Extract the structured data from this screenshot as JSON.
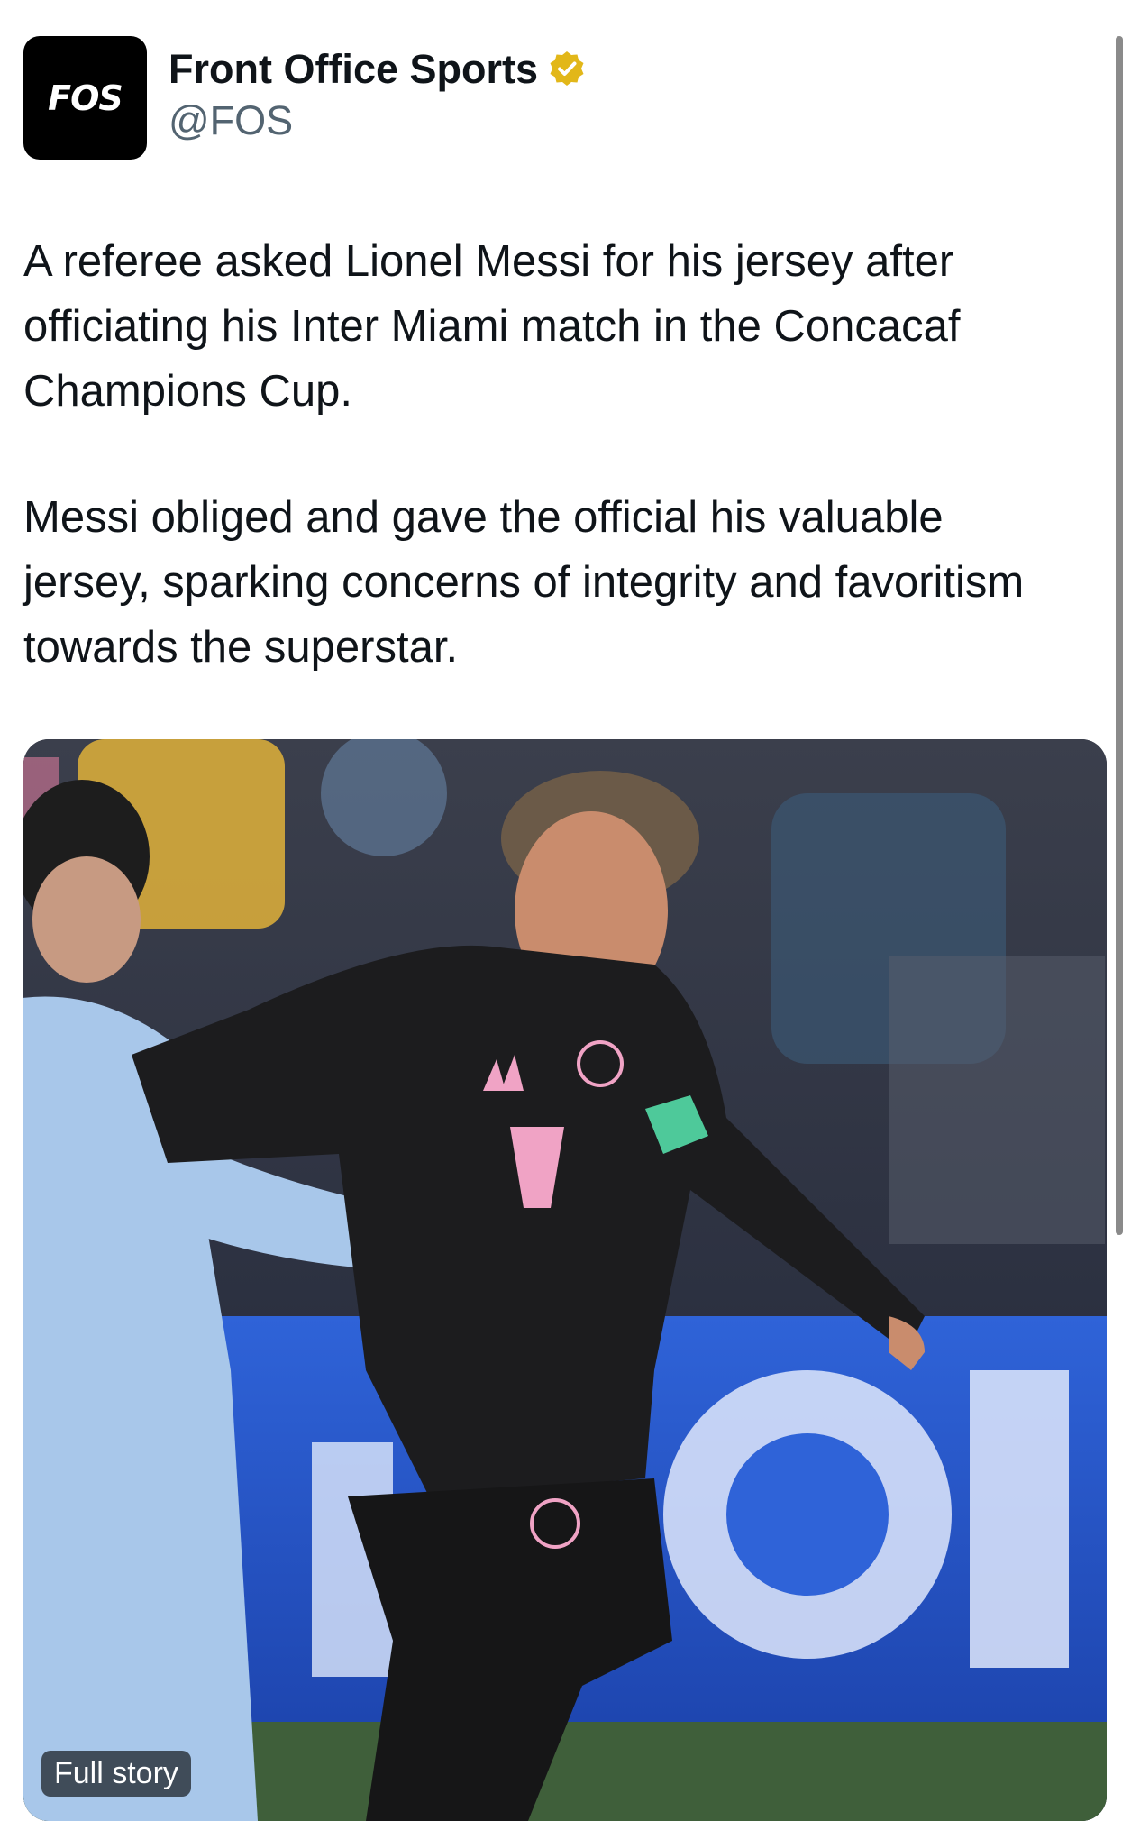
{
  "account": {
    "avatar_text": "FOS",
    "display_name": "Front Office Sports",
    "handle": "@FOS",
    "verified_icon": "verified-badge-gold"
  },
  "tweet": {
    "paragraphs": [
      "A referee asked Lionel Messi for his jersey after officiating his Inter Miami match in the Concacaf Champions Cup.",
      "Messi obliged and gave the official his valuable jersey, sparking concerns of integrity and favoritism towards the superstar."
    ]
  },
  "media": {
    "card_label": "Full story",
    "photo_icon": "soccer-photo"
  },
  "colors": {
    "text": "#0f1419",
    "secondary": "#536471",
    "verified_gold": "#e2b719",
    "jersey_pink": "#f0a3c5"
  }
}
